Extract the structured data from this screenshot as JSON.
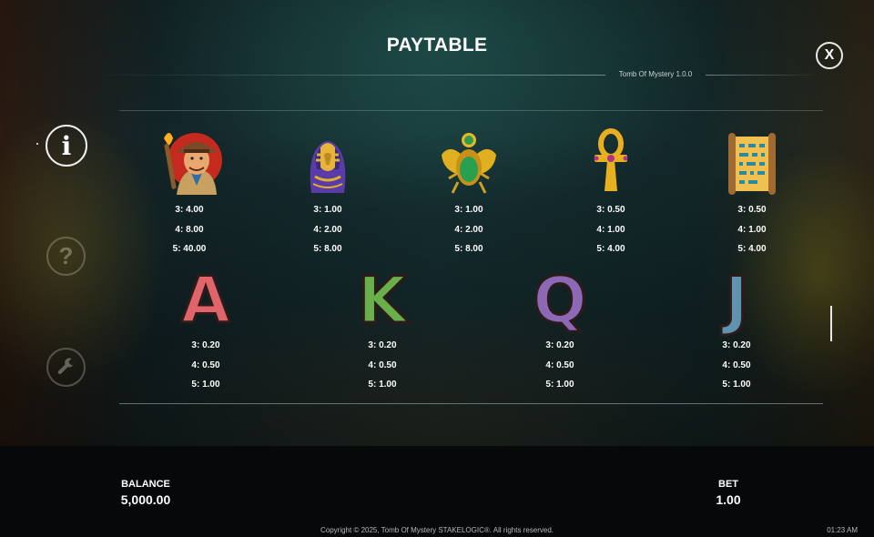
{
  "header": {
    "title": "PAYTABLE",
    "version": "Tomb Of Mystery 1.0.0",
    "close_label": "X"
  },
  "sidebar": {
    "items": [
      {
        "name": "info",
        "glyph": "i",
        "active": true
      },
      {
        "name": "help",
        "glyph": "?",
        "active": false
      },
      {
        "name": "settings",
        "glyph": "wrench",
        "active": false
      }
    ]
  },
  "symbols_top": [
    {
      "name": "explorer",
      "pays": [
        "3: 4.00",
        "4: 8.00",
        "5: 40.00"
      ]
    },
    {
      "name": "pharaoh-sarcophagus",
      "pays": [
        "3: 1.00",
        "4: 2.00",
        "5: 8.00"
      ]
    },
    {
      "name": "scarab",
      "pays": [
        "3: 1.00",
        "4: 2.00",
        "5: 8.00"
      ]
    },
    {
      "name": "ankh",
      "pays": [
        "3: 0.50",
        "4: 1.00",
        "5: 4.00"
      ]
    },
    {
      "name": "scroll",
      "pays": [
        "3: 0.50",
        "4: 1.00",
        "5: 4.00"
      ]
    }
  ],
  "symbols_bottom": [
    {
      "name": "A",
      "color": "#e0656a",
      "pays": [
        "3: 0.20",
        "4: 0.50",
        "5: 1.00"
      ]
    },
    {
      "name": "K",
      "color": "#6ab04a",
      "pays": [
        "3: 0.20",
        "4: 0.50",
        "5: 1.00"
      ]
    },
    {
      "name": "Q",
      "color": "#8d69b5",
      "pays": [
        "3: 0.20",
        "4: 0.50",
        "5: 1.00"
      ]
    },
    {
      "name": "J",
      "color": "#5f93b0",
      "pays": [
        "3: 0.20",
        "4: 0.50",
        "5: 1.00"
      ]
    }
  ],
  "footer": {
    "balance_label": "BALANCE",
    "balance_value": "5,000.00",
    "bet_label": "BET",
    "bet_value": "1.00",
    "copyright": "Copyright © 2025, Tomb Of Mystery STAKELOGIC®. All rights reserved.",
    "clock": "01:23 AM"
  }
}
